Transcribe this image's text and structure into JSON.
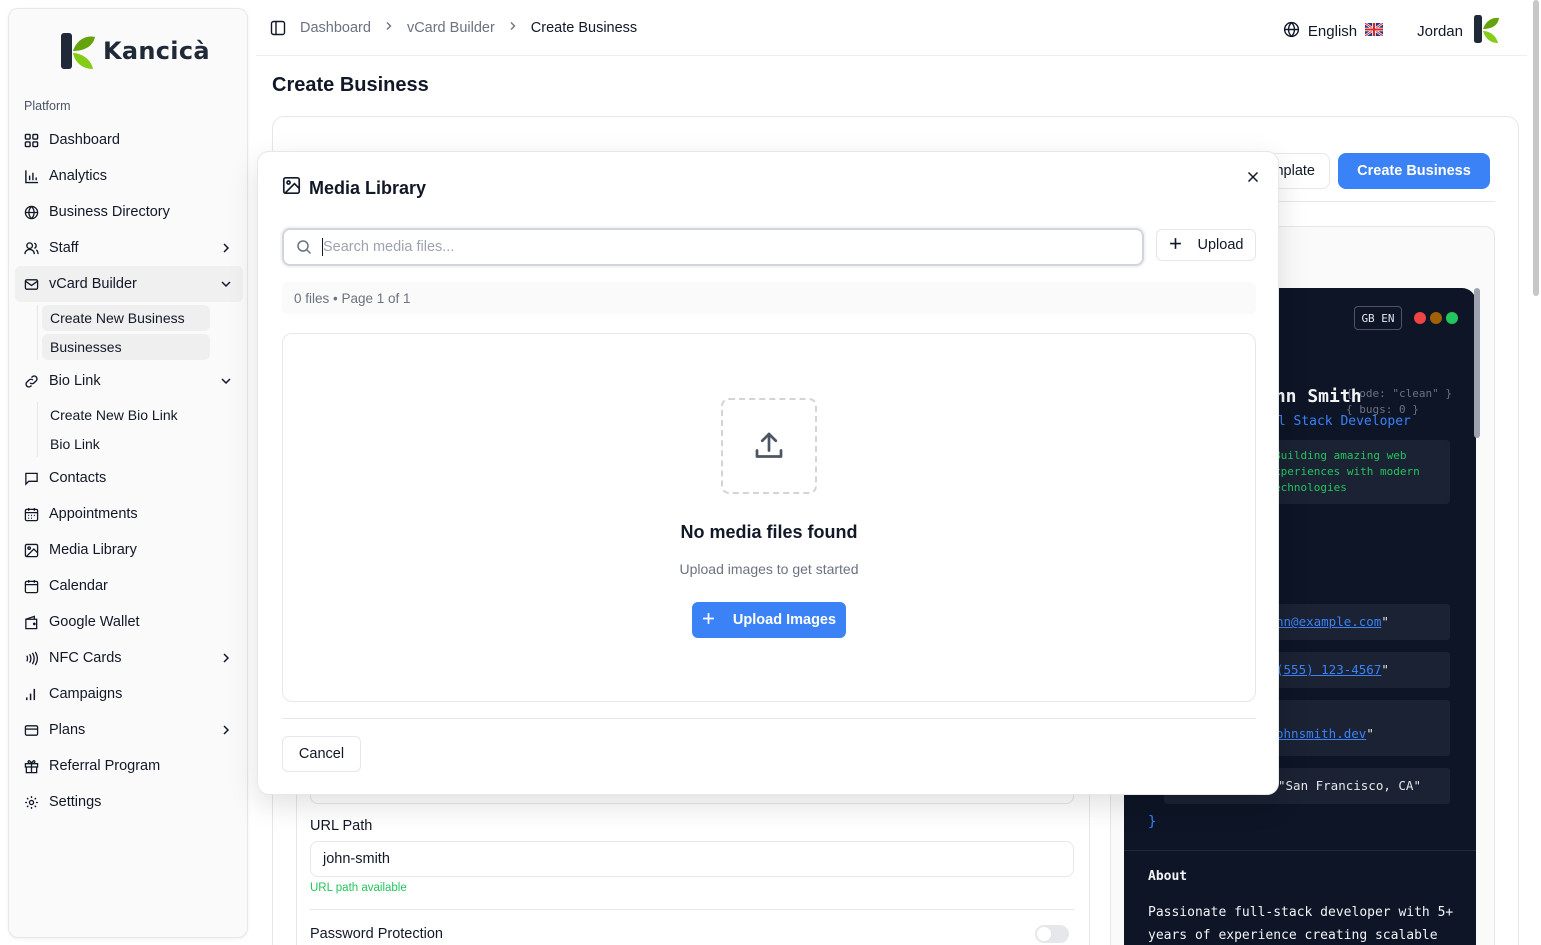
{
  "brand": {
    "name": "Kancicà"
  },
  "sidebar": {
    "section_label": "Platform",
    "items": [
      {
        "label": "Dashboard",
        "icon": "grid-icon"
      },
      {
        "label": "Analytics",
        "icon": "bar-chart-icon"
      },
      {
        "label": "Business Directory",
        "icon": "globe-icon"
      },
      {
        "label": "Staff",
        "icon": "users-icon"
      },
      {
        "label": "vCard Builder",
        "icon": "mail-icon"
      },
      {
        "label": "Bio Link",
        "icon": "link-icon"
      },
      {
        "label": "Contacts",
        "icon": "message-square-icon"
      },
      {
        "label": "Appointments",
        "icon": "calendar-grid-icon"
      },
      {
        "label": "Media Library",
        "icon": "image-icon"
      },
      {
        "label": "Calendar",
        "icon": "calendar-icon"
      },
      {
        "label": "Google Wallet",
        "icon": "wallet-icon"
      },
      {
        "label": "NFC Cards",
        "icon": "nfc-icon"
      },
      {
        "label": "Campaigns",
        "icon": "signal-icon"
      },
      {
        "label": "Plans",
        "icon": "credit-card-icon"
      },
      {
        "label": "Referral Program",
        "icon": "gift-icon"
      },
      {
        "label": "Settings",
        "icon": "gear-icon"
      }
    ],
    "vcard_sub": [
      "Create New Business",
      "Businesses"
    ],
    "biolink_sub": [
      "Create New Bio Link",
      "Bio Link"
    ]
  },
  "breadcrumb": {
    "items": [
      "Dashboard",
      "vCard Builder",
      "Create Business"
    ]
  },
  "header": {
    "language": "English",
    "user": "Jordan"
  },
  "page": {
    "title": "Create Business"
  },
  "actions": {
    "template_label": "nplate",
    "create_label": "Create Business"
  },
  "form": {
    "url_label": "URL Path",
    "url_value": "john-smith",
    "url_hint": "URL path available",
    "password_label": "Password Protection",
    "password_enabled": false
  },
  "preview": {
    "lang_badge": "GB EN",
    "name": "ohn Smith",
    "title": "ll Stack Developer",
    "comment_1": "{ ode: \"clean\" }",
    "comment_2": "{ bugs: 0 }",
    "bio_lines": [
      "Building amazing web",
      "xperiences with modern",
      "echnologies"
    ],
    "email": "hn@example.com",
    "phone": "(555) 123-4567",
    "website": "ohnsmith.dev",
    "location": "\"San Francisco, CA\"",
    "quote": "\"",
    "brace": "}",
    "about_title": "About",
    "about_text": "Passionate full-stack developer with 5+ years of experience creating scalable"
  },
  "modal": {
    "title": "Media Library",
    "search_placeholder": "Search media files...",
    "search_value": "",
    "upload_label": "Upload",
    "status": "0 files • Page 1 of 1",
    "empty_title": "No media files found",
    "empty_sub": "Upload images to get started",
    "upload_images_label": "Upload Images",
    "cancel_label": "Cancel"
  },
  "colors": {
    "accent": "#3b82f6",
    "terminal_bg": "#0d1526",
    "success": "#22c55e"
  }
}
